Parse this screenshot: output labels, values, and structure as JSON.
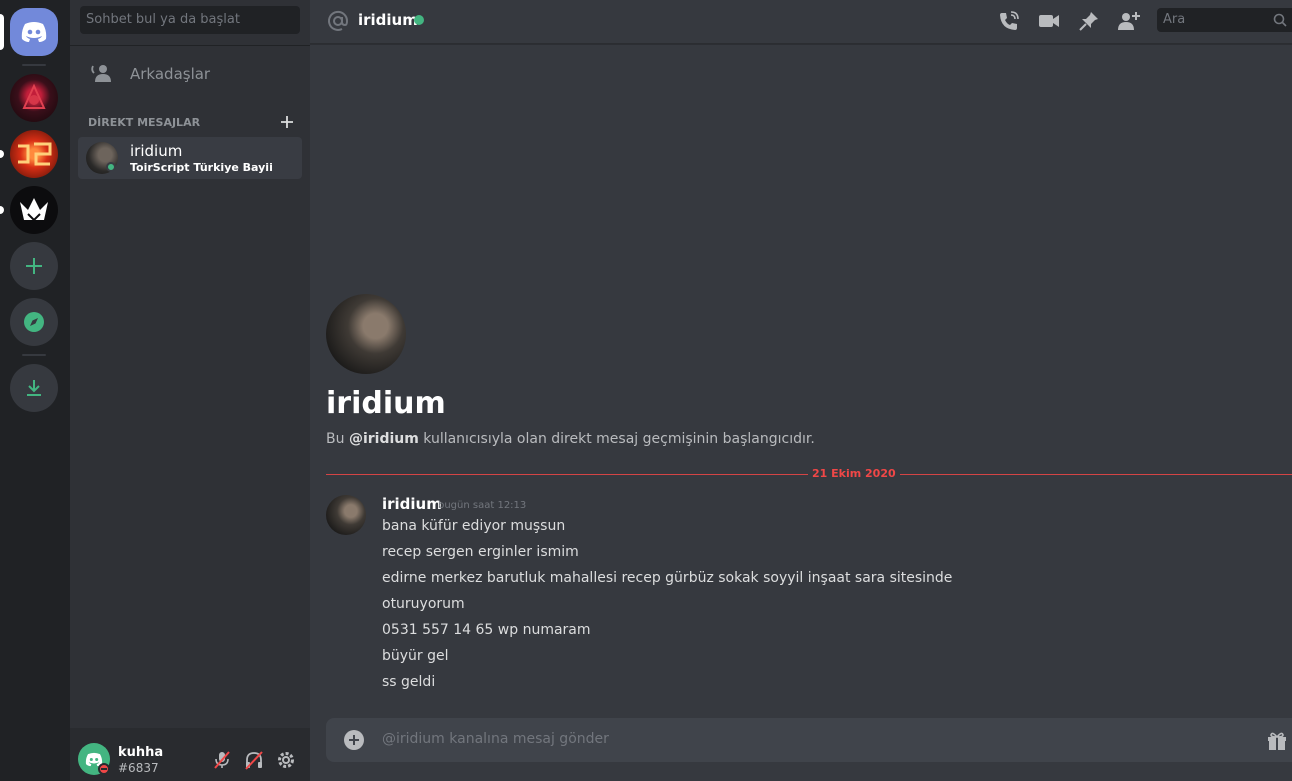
{
  "servers": [
    {
      "name": "discord-home",
      "icon": "discord-logo-icon"
    },
    {
      "name": "server-1",
      "icon": "server-avatar"
    },
    {
      "name": "server-2",
      "icon": "server-avatar"
    },
    {
      "name": "server-3",
      "icon": "server-avatar"
    },
    {
      "name": "add-server",
      "icon": "plus-icon"
    },
    {
      "name": "explore",
      "icon": "compass-icon"
    },
    {
      "name": "download",
      "icon": "download-icon"
    }
  ],
  "sidebar": {
    "search_placeholder": "Sohbet bul ya da başlat",
    "friends_label": "Arkadaşlar",
    "dm_header": "DİREKT MESAJLAR",
    "dms": [
      {
        "name": "iridium",
        "status": "ToirScript Türkiye Bayii",
        "presence": "online"
      }
    ]
  },
  "user": {
    "name": "kuhha",
    "tag": "#6837",
    "presence": "dnd"
  },
  "topbar": {
    "channel": "iridium",
    "search_placeholder": "Ara"
  },
  "intro": {
    "title": "iridium",
    "text_prefix": "Bu ",
    "text_mention": "@iridium",
    "text_suffix": " kullanıcısıyla olan direkt mesaj geçmişinin başlangıcıdır."
  },
  "date_divider": "21 Ekim 2020",
  "message": {
    "author": "iridium",
    "time": "bugün saat 12:13",
    "lines": [
      "bana küfür ediyor muşsun",
      "recep sergen erginler ismim",
      "edirne merkez barutluk mahallesi recep gürbüz sokak soyyil inşaat sara sitesinde",
      "oturuyorum",
      "0531 557 14 65 wp numaram",
      "büyür gel",
      "ss geldi"
    ]
  },
  "composer": {
    "placeholder": "@iridium kanalına mesaj gönder"
  },
  "colors": {
    "accent": "#7289da",
    "online": "#43b581",
    "dnd": "#f04747",
    "divider": "#f04747"
  }
}
